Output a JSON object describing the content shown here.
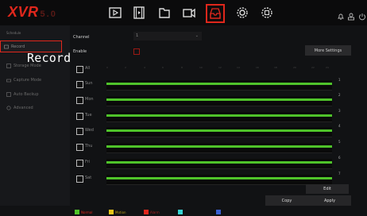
{
  "app": {
    "logo": "XVR",
    "version": "5.0"
  },
  "sidebar": {
    "header": "Schedule",
    "items": [
      {
        "label": "Record",
        "icon": "record-icon"
      },
      {
        "label": "Storage Mode",
        "icon": "storage-icon"
      },
      {
        "label": "Capture Mode",
        "icon": "capture-icon"
      },
      {
        "label": "Auto Backup",
        "icon": "backup-icon"
      },
      {
        "label": "Advanced",
        "icon": "gear-icon"
      }
    ],
    "overlay_label": "Record"
  },
  "form": {
    "channel_label": "Channel",
    "channel_value": "1",
    "enable_label": "Enable",
    "more_settings": "More Settings"
  },
  "schedule": {
    "all_label": "All",
    "hours": [
      "0",
      "2",
      "4",
      "6",
      "8",
      "10",
      "12",
      "14",
      "16",
      "18",
      "20",
      "22",
      "24"
    ],
    "days": [
      {
        "label": "Sun",
        "num": "1"
      },
      {
        "label": "Mon",
        "num": "2"
      },
      {
        "label": "Tue",
        "num": "3"
      },
      {
        "label": "Wed",
        "num": "4"
      },
      {
        "label": "Thu",
        "num": "5"
      },
      {
        "label": "Fri",
        "num": "6"
      },
      {
        "label": "Sat",
        "num": "7"
      }
    ]
  },
  "legend": [
    {
      "label": "Normal",
      "color": "#4fc32a",
      "text_color": "#e0271c"
    },
    {
      "label": "Motion",
      "color": "#e6c41a",
      "text_color": "#b59a19"
    },
    {
      "label": "Alarm",
      "color": "#e0271c",
      "text_color": "#a22"
    },
    {
      "label": "",
      "color": "#37d3d3",
      "text_color": "#244"
    },
    {
      "label": "",
      "color": "#3a5fd0",
      "text_color": "#2a3f7a"
    }
  ],
  "buttons": {
    "edit": "Edit",
    "copy": "Copy",
    "apply": "Apply"
  },
  "colors": {
    "accent": "#e0271c",
    "schedule_bar": "#4fc32a"
  }
}
